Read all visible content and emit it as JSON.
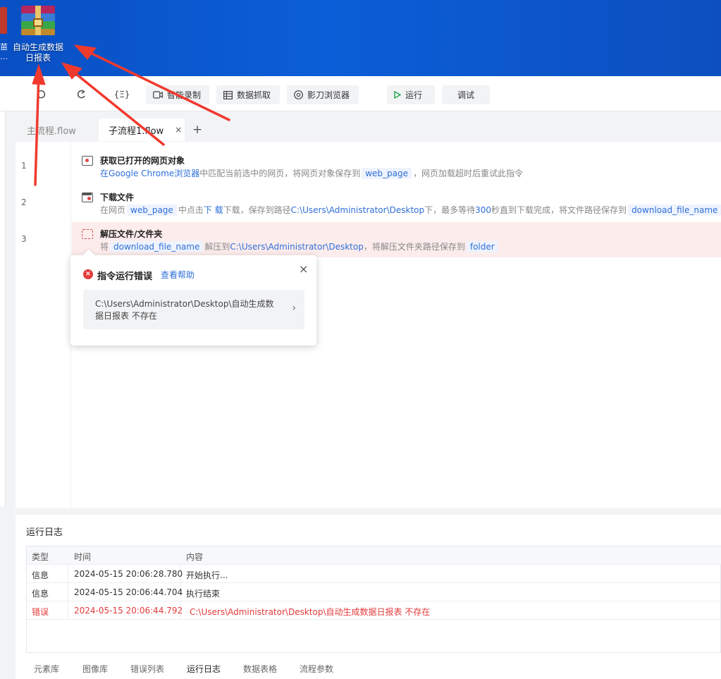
{
  "desktop": {
    "left_icon_label": "苗\n…",
    "rar_icon_label": "自动生成数据\n日报表"
  },
  "toolbar": {
    "smart_record": "智能录制",
    "data_capture": "数据抓取",
    "browser": "影刀浏览器",
    "run": "运行",
    "debug": "调试"
  },
  "tabs": {
    "main": "主流程.flow",
    "sub": "子流程1.flow",
    "close": "×",
    "add": "+"
  },
  "steps": [
    {
      "line": "1",
      "title": "获取已打开的网页对象",
      "desc": {
        "p1": "在",
        "browser": "Google Chrome浏览器",
        "p2": "中匹配当前选中的网页，将网页对象保存到",
        "var": "web_page",
        "p3": "，网页加载超时后重试此指令"
      }
    },
    {
      "line": "2",
      "title": "下载文件",
      "desc": {
        "p1": "在网页",
        "var": "web_page",
        "p2": "中点击",
        "target": "下 载",
        "p3": "下载，保存到路径",
        "path": "C:\\Users\\Administrator\\Desktop",
        "p4": "下，最多等待",
        "secs": "300",
        "p5": "秒直到下载完成，将文件路径保存到",
        "var2": "download_file_name"
      }
    },
    {
      "line": "3",
      "title": "解压文件/文件夹",
      "desc": {
        "p1": "将",
        "var": "download_file_name",
        "p2": "解压到",
        "path": "C:\\Users\\Administrator\\Desktop",
        "p3": "，将解压文件夹路径保存到",
        "var2": "folder"
      }
    }
  ],
  "error_popup": {
    "title": "指令运行错误",
    "help": "查看帮助",
    "close": "×",
    "message": "C:\\Users\\Administrator\\Desktop\\自动生成数据日报表 不存在",
    "chevron": "›"
  },
  "log": {
    "title": "运行日志",
    "headers": [
      "类型",
      "时间",
      "内容"
    ],
    "rows": [
      {
        "type": "信息",
        "time": "2024-05-15 20:06:28.780",
        "content": "开始执行..."
      },
      {
        "type": "信息",
        "time": "2024-05-15 20:06:44.704",
        "content": "执行结束"
      },
      {
        "type": "错误",
        "time": "2024-05-15 20:06:44.792",
        "content": "C:\\Users\\Administrator\\Desktop\\自动生成数据日报表 不存在"
      }
    ],
    "bottom_tabs": [
      "元素库",
      "图像库",
      "错误列表",
      "运行日志",
      "数据表格",
      "流程参数"
    ]
  },
  "colors": {
    "desktop_blue": "#0b5ed7",
    "accent_blue": "#2f6fd8",
    "error_red": "#e33a3a",
    "run_green": "#20a44c",
    "annotation_red": "#f03a2e"
  }
}
